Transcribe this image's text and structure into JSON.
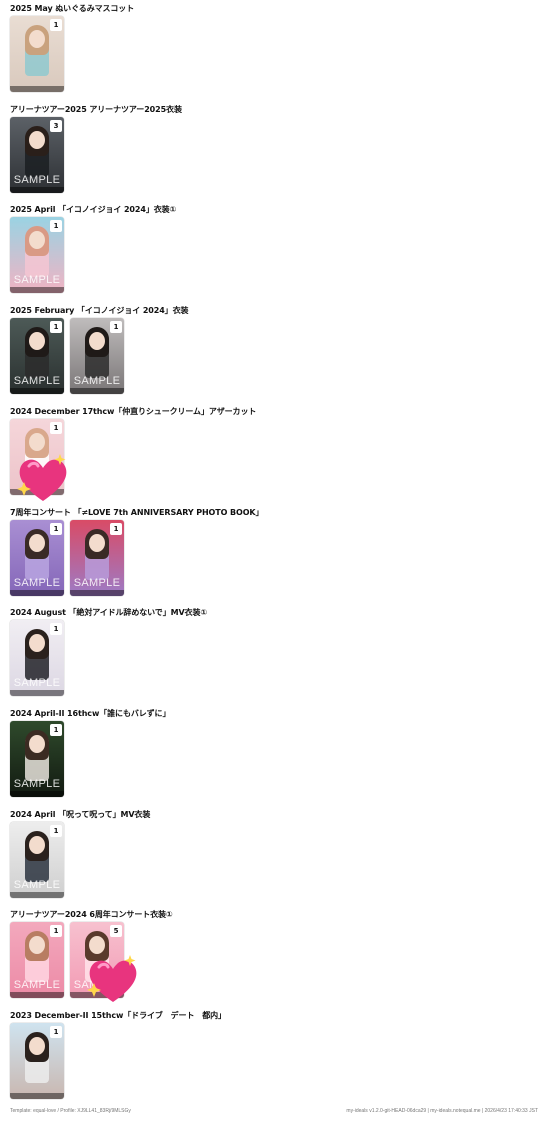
{
  "sections": [
    {
      "title": "2025 May ぬいぐるみマスコット",
      "cards": [
        {
          "count": "1",
          "sample": "",
          "bg": "linear-gradient(180deg,#e9ddd3 0%,#d9c9bd 100%)",
          "figure": "#8fc9cf",
          "hair": "#c9a27e"
        }
      ]
    },
    {
      "title": "アリーナツアー2025 アリーナツアー2025衣装",
      "cards": [
        {
          "count": "3",
          "sample": "SAMPLE",
          "bg": "linear-gradient(180deg,#5c6167 0%,#2d3034 100%)",
          "figure": "#1b1f22",
          "hair": "#2a1f1a"
        }
      ]
    },
    {
      "title": "2025 April 「イコノイジョイ 2024」衣装①",
      "cards": [
        {
          "count": "1",
          "sample": "SAMPLE",
          "bg": "linear-gradient(180deg,#9ad3e3 0%,#f1b3c3 100%)",
          "figure": "#f5c6d2",
          "hair": "#d99a85"
        }
      ]
    },
    {
      "title": "2025 February 「イコノイジョイ 2024」衣装",
      "cards": [
        {
          "count": "1",
          "sample": "SAMPLE",
          "bg": "linear-gradient(180deg,#4d5a57 0%,#2a302f 100%)",
          "figure": "#2b2b2b",
          "hair": "#1f1a18"
        },
        {
          "count": "1",
          "sample": "SAMPLE",
          "bg": "linear-gradient(180deg,#bfbcbc 0%,#7a7677 100%)",
          "figure": "#2d2d2d",
          "hair": "#1f1a18"
        }
      ]
    },
    {
      "title": "2024 December 17thcw「仲直りシュークリーム」アザーカット",
      "cards": [
        {
          "count": "1",
          "sample": "",
          "bg": "linear-gradient(180deg,#f5d6da 0%,#ecc3c9 100%)",
          "figure": "#ffffff",
          "hair": "#d9a88c"
        }
      ]
    },
    {
      "title": "7周年コンサート 「≠LOVE 7th ANNIVERSARY PHOTO BOOK」",
      "cards": [
        {
          "count": "1",
          "sample": "SAMPLE",
          "bg": "linear-gradient(180deg,#a98fd3 0%,#8466b8 100%)",
          "figure": "#b8a4e0",
          "hair": "#3a2a26"
        },
        {
          "count": "1",
          "sample": "SAMPLE",
          "bg": "linear-gradient(180deg,#d94b66 0%,#9d7bc6 100%)",
          "figure": "#b79bd9",
          "hair": "#3a2a26"
        }
      ]
    },
    {
      "title": "2024 August 「絶対アイドル辞めないで」MV衣装①",
      "cards": [
        {
          "count": "1",
          "sample": "SAMPLE",
          "bg": "linear-gradient(180deg,#f1eef3 0%,#dcd7e3 100%)",
          "figure": "#222228",
          "hair": "#2a211d"
        }
      ]
    },
    {
      "title": "2024 April-II 16thcw「誰にもバレずに」",
      "cards": [
        {
          "count": "1",
          "sample": "SAMPLE",
          "bg": "linear-gradient(180deg,#2f4a2c 0%,#121a11 100%)",
          "figure": "#e8e3dc",
          "hair": "#3b2b22"
        }
      ]
    },
    {
      "title": "2024 April 「呪って呪って」MV衣装",
      "cards": [
        {
          "count": "1",
          "sample": "SAMPLE",
          "bg": "linear-gradient(180deg,#ededed 0%,#cfcfcf 100%)",
          "figure": "#2c3440",
          "hair": "#2a211d"
        }
      ]
    },
    {
      "title": "アリーナツアー2024 6周年コンサート衣装①",
      "cards": [
        {
          "count": "1",
          "sample": "SAMPLE",
          "bg": "linear-gradient(180deg,#f3a9bd 0%,#ec8aa6 100%)",
          "figure": "#ffd6e2",
          "hair": "#b87d62"
        },
        {
          "count": "5",
          "sample": "SAMPLE",
          "bg": "linear-gradient(180deg,#f7c1cf 0%,#f29bb4 100%)",
          "figure": "#ffe3ea",
          "hair": "#5a3a2c"
        }
      ]
    },
    {
      "title": "2023 December-II 15thcw「ドライブ　デート　都内」",
      "cards": [
        {
          "count": "1",
          "sample": "",
          "bg": "linear-gradient(180deg,#cfe3ef 0%,#c9b7b0 100%)",
          "figure": "#ececec",
          "hair": "#2a211d"
        }
      ]
    }
  ],
  "footer": {
    "left": "Template: equal-love / Profile: XJ9LL41_83Rj/9MLSGy",
    "right": "my-ideals v1.2.0-git-HEAD-06dca29 | my-ideals.notequal.me | 2026/4/23 17:40:33 JST"
  },
  "colors": {
    "heart_main": "#e8347e",
    "heart_light": "#ff8fc2",
    "sparkle": "#ffd84a"
  }
}
